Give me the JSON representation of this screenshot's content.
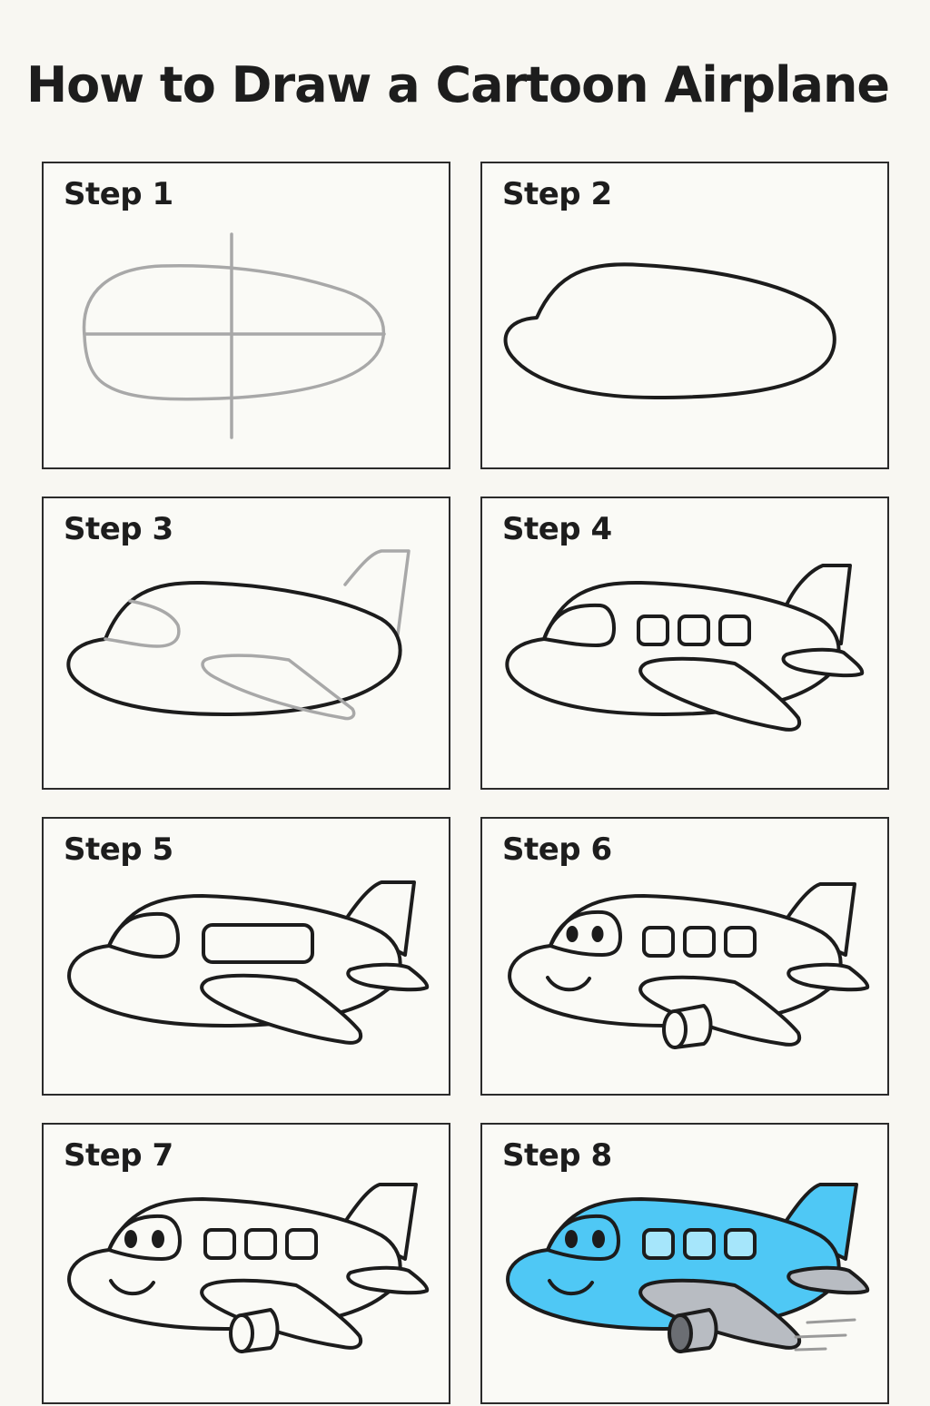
{
  "title": "How to Draw a Cartoon Airplane",
  "steps": [
    {
      "label": "Step 1"
    },
    {
      "label": "Step 2"
    },
    {
      "label": "Step 3"
    },
    {
      "label": "Step 4"
    },
    {
      "label": "Step 5"
    },
    {
      "label": "Step 6"
    },
    {
      "label": "Step 7"
    },
    {
      "label": "Step 8"
    }
  ],
  "colors": {
    "airplane_body": "#4fc8f5",
    "airplane_windows": "#a6e6fb",
    "airplane_wings": "#b8bcc2",
    "outline": "#1c1c1c",
    "guideline": "#a8a8a8"
  }
}
